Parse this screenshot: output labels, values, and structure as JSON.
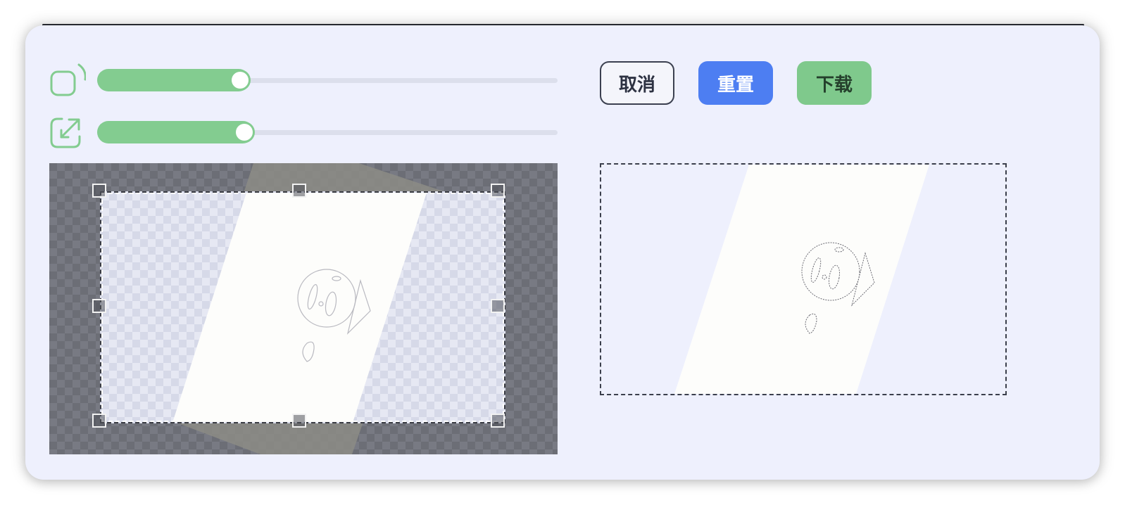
{
  "controls": {
    "rotate": {
      "icon": "rotate-icon",
      "value": 0.31
    },
    "scale": {
      "icon": "scale-icon",
      "value": 0.32
    }
  },
  "buttons": {
    "cancel_label": "取消",
    "reset_label": "重置",
    "download_label": "下载"
  },
  "colors": {
    "panel_bg": "#eef0fd",
    "slider_fill": "#83cc90",
    "reset_button": "#4d7ef2",
    "download_button": "#7fc98c",
    "cancel_border": "#3b4050"
  },
  "editor": {
    "crop_handles": [
      "top-left",
      "top-center",
      "top-right",
      "middle-left",
      "middle-right",
      "bottom-left",
      "bottom-center",
      "bottom-right"
    ]
  }
}
